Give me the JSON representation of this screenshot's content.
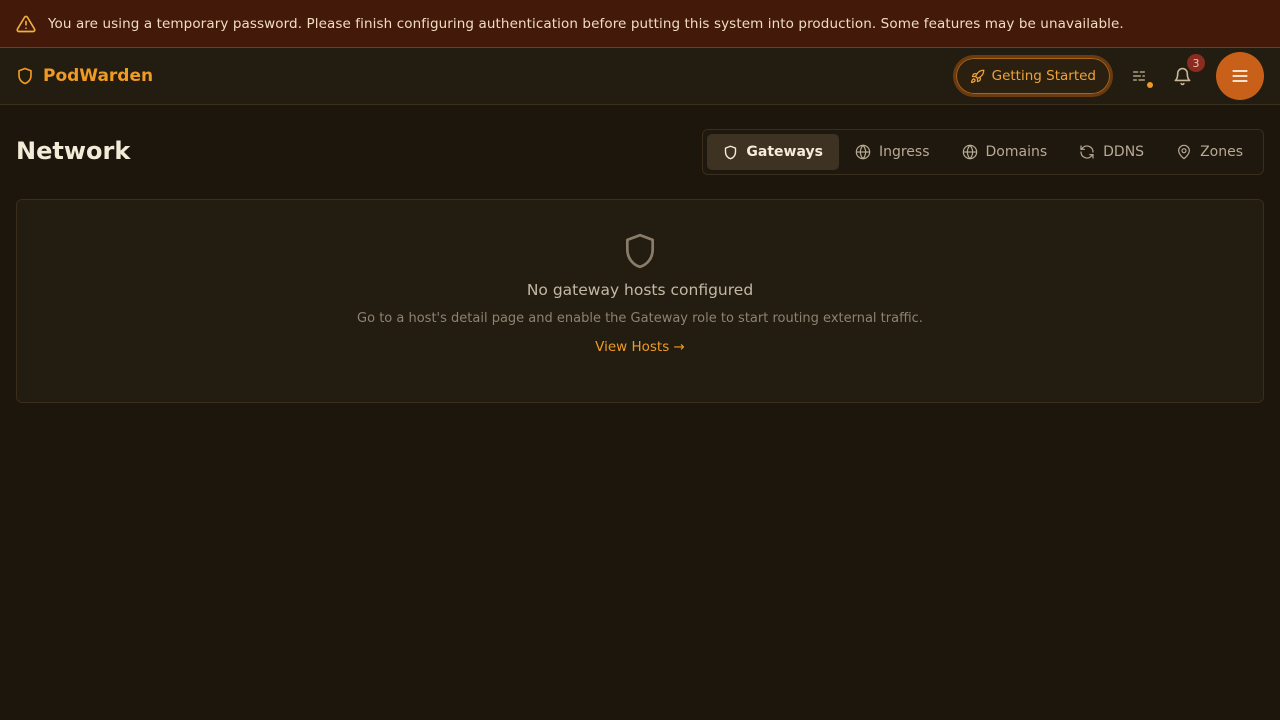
{
  "banner": {
    "icon": "warning-triangle-icon",
    "text": "You are using a temporary password. Please finish configuring authentication before putting this system into production. Some features may be unavailable."
  },
  "header": {
    "brand": "PodWarden",
    "brand_icon": "shield-icon",
    "getting_started_label": "Getting Started",
    "notification_count": "3"
  },
  "page": {
    "title": "Network",
    "tabs": [
      {
        "label": "Gateways",
        "icon": "shield-icon",
        "active": true
      },
      {
        "label": "Ingress",
        "icon": "globe-icon",
        "active": false
      },
      {
        "label": "Domains",
        "icon": "globe-icon",
        "active": false
      },
      {
        "label": "DDNS",
        "icon": "refresh-icon",
        "active": false
      },
      {
        "label": "Zones",
        "icon": "map-pin-icon",
        "active": false
      }
    ]
  },
  "empty_state": {
    "icon": "shield-icon",
    "title": "No gateway hosts configured",
    "description": "Go to a host's detail page and enable the Gateway role to start routing external traffic.",
    "link": "View Hosts →"
  },
  "colors": {
    "accent": "#f09a22",
    "background": "#1c160d",
    "banner": "#43190a",
    "menu_button": "#c9601a"
  }
}
